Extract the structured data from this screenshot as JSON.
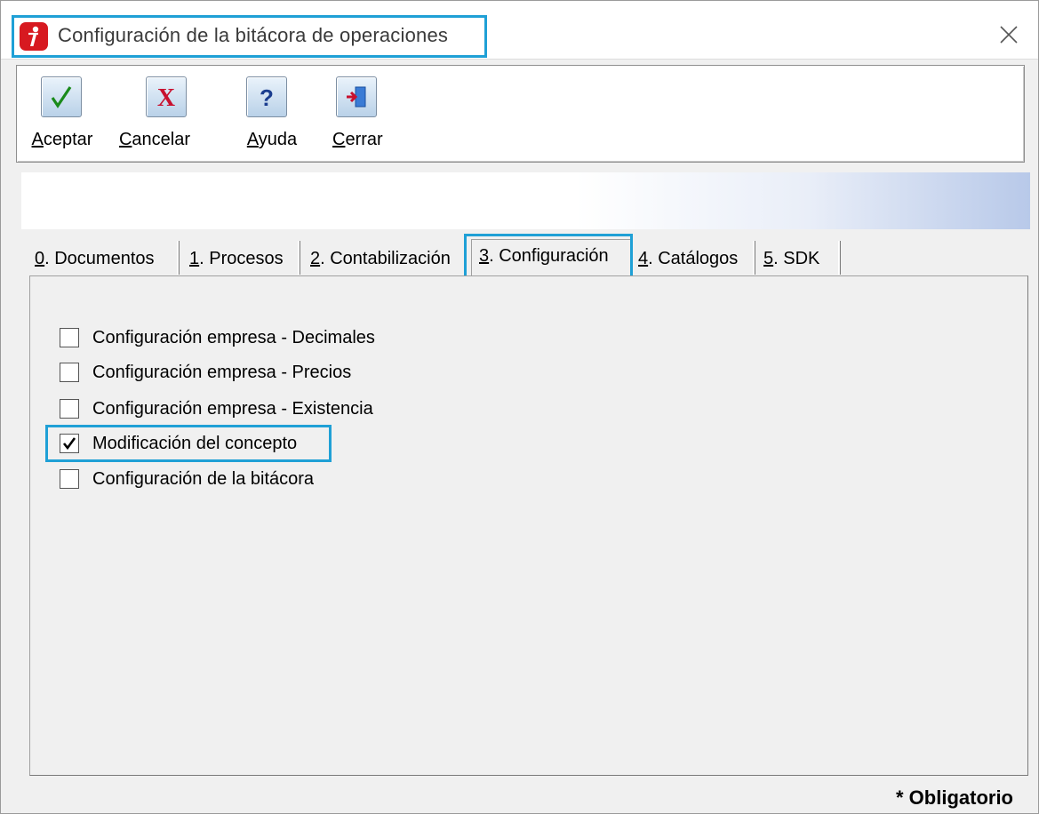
{
  "window": {
    "title": "Configuración de la bitácora de operaciones",
    "app_icon": "app-logo-icon",
    "close_icon": "close-icon"
  },
  "toolbar": {
    "buttons": [
      {
        "label": "Aceptar",
        "icon": "checkmark-icon",
        "color": "#1a8a1a"
      },
      {
        "label": "Cancelar",
        "icon": "x-icon",
        "color": "#c8102e"
      },
      {
        "label": "Ayuda",
        "icon": "help-icon",
        "color": "#1a3d8f"
      },
      {
        "label": "Cerrar",
        "icon": "exit-door-icon",
        "color": "#1a5fb4"
      }
    ]
  },
  "tabs": {
    "items": [
      {
        "num": "0",
        "label": ". Documentos"
      },
      {
        "num": "1",
        "label": ". Procesos"
      },
      {
        "num": "2",
        "label": ". Contabilización"
      },
      {
        "num": "3",
        "label": ". Configuración"
      },
      {
        "num": "4",
        "label": ". Catálogos"
      },
      {
        "num": "5",
        "label": ". SDK"
      }
    ],
    "active_index": 3
  },
  "options": [
    {
      "label": "Configuración empresa - Decimales",
      "checked": false
    },
    {
      "label": "Configuración empresa - Precios",
      "checked": false
    },
    {
      "label": "Configuración empresa - Existencia",
      "checked": false
    },
    {
      "label": "Modificación del concepto",
      "checked": true
    },
    {
      "label": "Configuración de la bitácora",
      "checked": false
    }
  ],
  "footer": {
    "required_label": "* Obligatorio"
  },
  "colors": {
    "highlight": "#1fa0d6",
    "brand_red": "#d71920"
  }
}
